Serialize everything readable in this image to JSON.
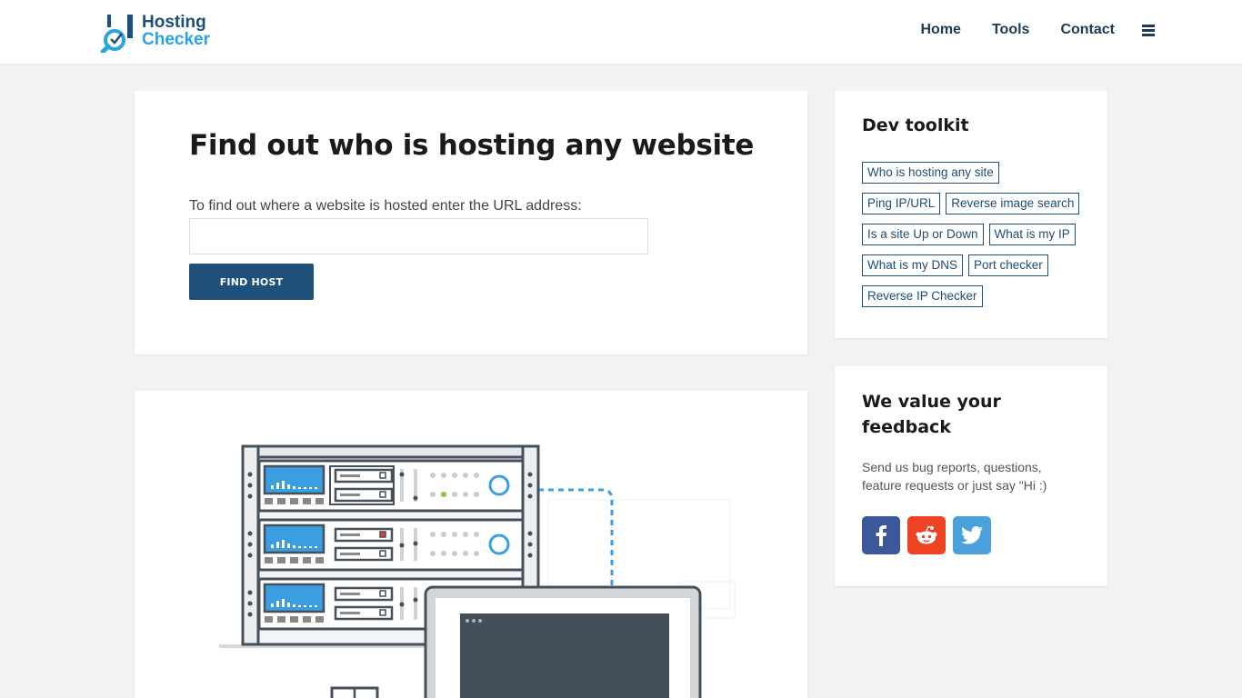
{
  "header": {
    "logo": {
      "line1": "Hosting",
      "line2": "Checker"
    },
    "nav": [
      {
        "label": "Home"
      },
      {
        "label": "Tools"
      },
      {
        "label": "Contact"
      }
    ],
    "menu_icon": "hamburger-icon"
  },
  "search": {
    "title": "Find out who is hosting any website",
    "prompt": "To find out where a website is hosted enter the URL address:",
    "url_value": "",
    "button_label": "FIND HOST"
  },
  "toolkit": {
    "title": "Dev toolkit",
    "tags": [
      "Who is hosting any site",
      "Ping IP/URL",
      "Reverse image search",
      "Is a site Up or Down",
      "What is my IP",
      "What is my DNS",
      "Port checker",
      "Reverse IP Checker"
    ]
  },
  "feedback": {
    "title": "We value your feedback",
    "description": "Send us bug reports, questions, feature requests or just say \"Hi :)",
    "social": [
      {
        "icon": "facebook-icon",
        "color": "#3b5998"
      },
      {
        "icon": "reddit-icon",
        "color": "#ee4323"
      },
      {
        "icon": "twitter-icon",
        "color": "#4aa1dd"
      }
    ]
  },
  "colors": {
    "brand_dark": "#1e5079",
    "brand_light": "#2aa3e0",
    "background": "#f2f2f2"
  }
}
